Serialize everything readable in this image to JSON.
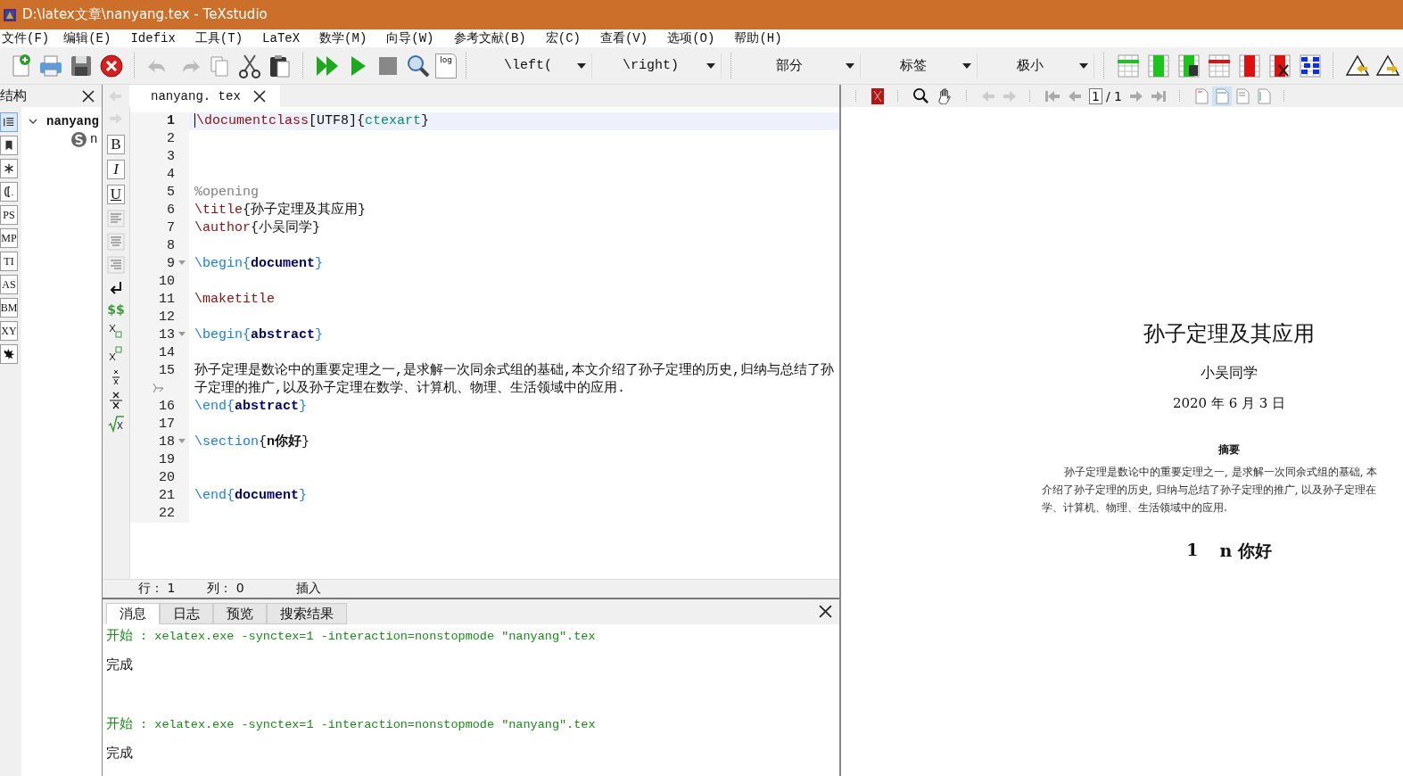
{
  "window": {
    "title": "D:\\latex文章\\nanyang.tex - TeXstudio"
  },
  "menu": [
    "文件(F)",
    "编辑(E)",
    "Idefix",
    "工具(T)",
    "LaTeX",
    "数学(M)",
    "向导(W)",
    "参考文献(B)",
    "宏(C)",
    "查看(V)",
    "选项(O)",
    "帮助(H)"
  ],
  "toolbar": {
    "log_label": "log",
    "dropdowns": [
      "\\left(",
      "\\right)",
      "部分",
      "标签",
      "极小"
    ]
  },
  "structure": {
    "title": "结构",
    "strip": [
      {
        "kind": "list",
        "selected": true
      },
      {
        "kind": "bookmark",
        "selected": false
      },
      {
        "kind": "asterisk",
        "selected": false
      },
      {
        "kind": "brackets",
        "selected": false
      },
      {
        "kind": "text",
        "label": "PS",
        "selected": false
      },
      {
        "kind": "text",
        "label": "MP",
        "selected": false
      },
      {
        "kind": "text",
        "label": "TI",
        "selected": false
      },
      {
        "kind": "text",
        "label": "AS",
        "selected": false
      },
      {
        "kind": "text",
        "label": "BM",
        "selected": false
      },
      {
        "kind": "text",
        "label": "XY",
        "selected": false
      },
      {
        "kind": "splat",
        "selected": false
      }
    ],
    "tree": [
      {
        "label": "nanyang",
        "expanded": true,
        "children": [
          {
            "label": "n"
          }
        ]
      }
    ]
  },
  "tabs": [
    {
      "label": "nanyang. tex",
      "selected": true
    }
  ],
  "format_strip": [
    {
      "kind": "bold",
      "label": "B"
    },
    {
      "kind": "italic",
      "label": "I"
    },
    {
      "kind": "underline",
      "label": "U"
    },
    {
      "kind": "align-left"
    },
    {
      "kind": "align-center"
    },
    {
      "kind": "align-right"
    },
    {
      "kind": "return"
    },
    {
      "kind": "dollar",
      "label": "$$"
    },
    {
      "kind": "subscript"
    },
    {
      "kind": "superscript"
    },
    {
      "kind": "small-fraction"
    },
    {
      "kind": "fraction"
    },
    {
      "kind": "sqrt"
    }
  ],
  "editor": {
    "lines": [
      {
        "n": "1",
        "current": true,
        "tokens": [
          {
            "kind": "cmd",
            "text": "\\documentclass"
          },
          {
            "kind": "plain",
            "text": "[UTF8]{"
          },
          {
            "kind": "arg",
            "text": "ctexart"
          },
          {
            "kind": "plain",
            "text": "}"
          }
        ]
      },
      {
        "n": "2"
      },
      {
        "n": "3"
      },
      {
        "n": "4"
      },
      {
        "n": "5",
        "tokens": [
          {
            "kind": "comment",
            "text": "%opening"
          }
        ]
      },
      {
        "n": "6",
        "tokens": [
          {
            "kind": "cmd",
            "text": "\\title"
          },
          {
            "kind": "plain",
            "text": "{孙子定理及其应用}"
          }
        ]
      },
      {
        "n": "7",
        "tokens": [
          {
            "kind": "cmd",
            "text": "\\author"
          },
          {
            "kind": "plain",
            "text": "{小吴同学}"
          }
        ]
      },
      {
        "n": "8"
      },
      {
        "n": "9",
        "foldable": true,
        "tokens": [
          {
            "kind": "env-cmd",
            "text": "\\begin{"
          },
          {
            "kind": "env",
            "text": "document"
          },
          {
            "kind": "env-cmd",
            "text": "}"
          }
        ]
      },
      {
        "n": "10"
      },
      {
        "n": "11",
        "tokens": [
          {
            "kind": "cmd",
            "text": "\\maketitle"
          }
        ]
      },
      {
        "n": "12"
      },
      {
        "n": "13",
        "foldable": true,
        "tokens": [
          {
            "kind": "env-cmd",
            "text": "\\begin{"
          },
          {
            "kind": "env",
            "text": "abstract"
          },
          {
            "kind": "env-cmd",
            "text": "}"
          }
        ]
      },
      {
        "n": "14"
      },
      {
        "n": "15",
        "wrapped": true,
        "tokens": [
          {
            "kind": "plain",
            "text": "孙子定理是数论中的重要定理之一,是求解一次同余式组的基础,本文介绍了孙子定理的历史,归纳与总结了孙子定理的推广,以及孙子定理在数学、计算机、物理、生活领域中的应用."
          }
        ]
      },
      {
        "n": "16",
        "tokens": [
          {
            "kind": "env-cmd",
            "text": "\\end{"
          },
          {
            "kind": "env",
            "text": "abstract"
          },
          {
            "kind": "env-cmd",
            "text": "}"
          }
        ]
      },
      {
        "n": "17"
      },
      {
        "n": "18",
        "foldable": true,
        "tokens": [
          {
            "kind": "env-cmd",
            "text": "\\section"
          },
          {
            "kind": "plain",
            "text": "{"
          },
          {
            "kind": "bold",
            "text": "n你好"
          },
          {
            "kind": "plain",
            "text": "}"
          }
        ]
      },
      {
        "n": "19"
      },
      {
        "n": "20"
      },
      {
        "n": "21",
        "tokens": [
          {
            "kind": "env-cmd",
            "text": "\\end{"
          },
          {
            "kind": "env",
            "text": "document"
          },
          {
            "kind": "env-cmd",
            "text": "}"
          }
        ]
      },
      {
        "n": "22"
      }
    ],
    "status": [
      "行： 1",
      "列： 0",
      "插入"
    ]
  },
  "messages": {
    "tabs": [
      {
        "label": "消息",
        "selected": true
      },
      {
        "label": "日志",
        "selected": false
      },
      {
        "label": "预览",
        "selected": false
      },
      {
        "label": "搜索结果",
        "selected": false
      }
    ],
    "entries": [
      {
        "kind": "start",
        "label": "开始",
        "text": " : xelatex.exe -synctex=1 -interaction=nonstopmode ″nanyang″.tex"
      },
      {
        "kind": "done",
        "text": "完成"
      },
      {
        "kind": "start",
        "label": "开始",
        "text": " : xelatex.exe -synctex=1 -interaction=nonstopmode ″nanyang″.tex"
      },
      {
        "kind": "done",
        "text": "完成"
      }
    ]
  },
  "viewer": {
    "page_field": "1",
    "page_total": "/ 1",
    "page": {
      "title": "孙子定理及其应用",
      "author": "小吴同学",
      "date": "2020 年 6 月 3 日",
      "abstract_heading": "摘要",
      "abstract_lines": [
        "孙子定理是数论中的重要定理之一, 是求解一次同余式组的基础, 本",
        "介绍了孙子定理的历史, 归纳与总结了孙子定理的推广, 以及孙子定理在",
        "学、计算机、物理、生活领域中的应用."
      ],
      "section_number": "1",
      "section_title": "n 你好"
    }
  }
}
